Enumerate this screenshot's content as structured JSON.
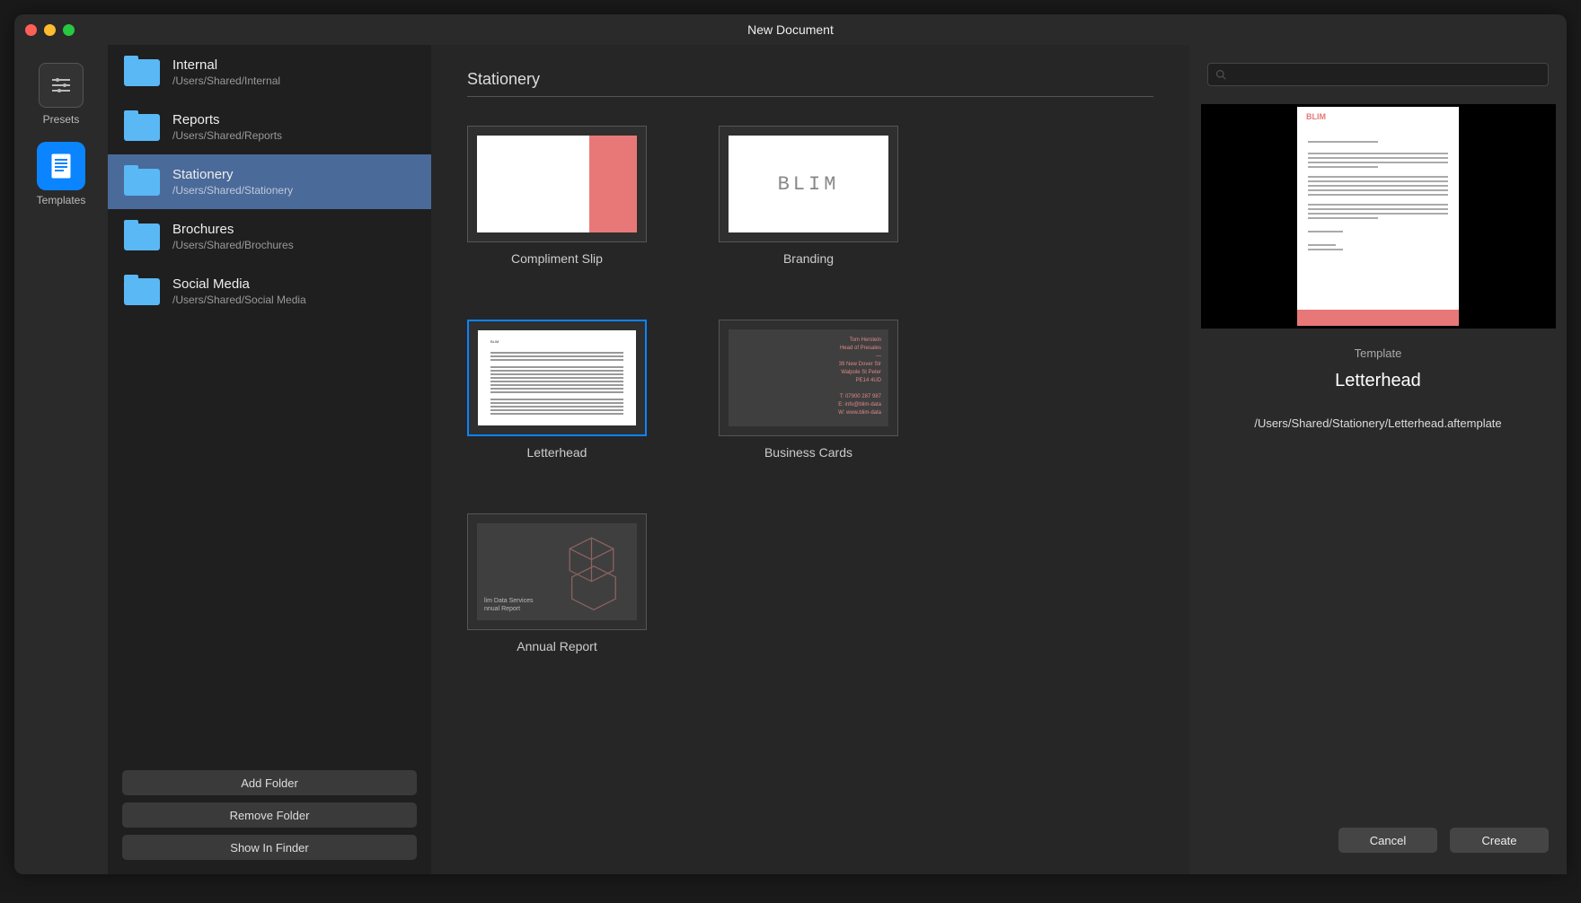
{
  "window": {
    "title": "New Document"
  },
  "nav": {
    "presets": "Presets",
    "templates": "Templates"
  },
  "folders": [
    {
      "name": "Internal",
      "path": "/Users/Shared/Internal",
      "selected": false
    },
    {
      "name": "Reports",
      "path": "/Users/Shared/Reports",
      "selected": false
    },
    {
      "name": "Stationery",
      "path": "/Users/Shared/Stationery",
      "selected": true
    },
    {
      "name": "Brochures",
      "path": "/Users/Shared/Brochures",
      "selected": false
    },
    {
      "name": "Social Media",
      "path": "/Users/Shared/Social Media",
      "selected": false
    }
  ],
  "folder_buttons": {
    "add": "Add Folder",
    "remove": "Remove Folder",
    "show": "Show In Finder"
  },
  "category_title": "Stationery",
  "templates": [
    {
      "name": "Compliment Slip",
      "kind": "compliment",
      "selected": false
    },
    {
      "name": "Branding",
      "kind": "branding",
      "selected": false
    },
    {
      "name": "Letterhead",
      "kind": "letterhead",
      "selected": true
    },
    {
      "name": "Business Cards",
      "kind": "businesscards",
      "selected": false
    },
    {
      "name": "Annual Report",
      "kind": "annual",
      "selected": false
    }
  ],
  "search": {
    "placeholder": ""
  },
  "preview": {
    "label": "Template",
    "name": "Letterhead",
    "path": "/Users/Shared/Stationery/Letterhead.aftemplate"
  },
  "buttons": {
    "cancel": "Cancel",
    "create": "Create"
  },
  "branding_text": "BLIM",
  "businesscard_lines": [
    "Tom Herstein",
    "Head of Presales",
    "—",
    "39 New Dover Str",
    "Walpole St Peter",
    "PE14 4UD",
    "",
    "T: 07900 287 987",
    "E: info@blim-data",
    "W: www.blim-data"
  ],
  "annual_lines": [
    "lim Data Services",
    "nnual Report"
  ]
}
